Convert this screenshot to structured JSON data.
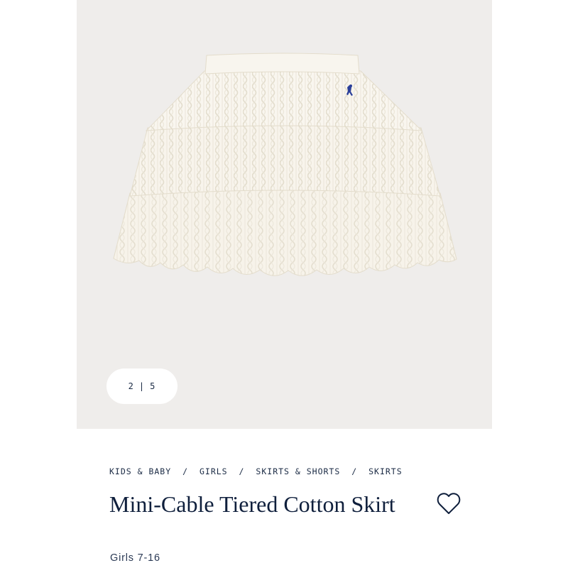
{
  "gallery": {
    "current": "2",
    "total": "5",
    "separator": "|",
    "image_description_icon": "white-cable-knit-tiered-skirt"
  },
  "breadcrumb": {
    "items": [
      "KIDS & BABY",
      "GIRLS",
      "SKIRTS & SHORTS",
      "SKIRTS"
    ],
    "separator": "/"
  },
  "product": {
    "title": "Mini-Cable Tiered Cotton Skirt",
    "subtitle": "Girls 7-16"
  },
  "wishlist": {
    "icon": "heart-icon"
  },
  "colors": {
    "navy": "#0f1f3c",
    "image_background": "#efedeb",
    "skirt": "#f7f3ea",
    "logo": "#2a3f9a"
  }
}
